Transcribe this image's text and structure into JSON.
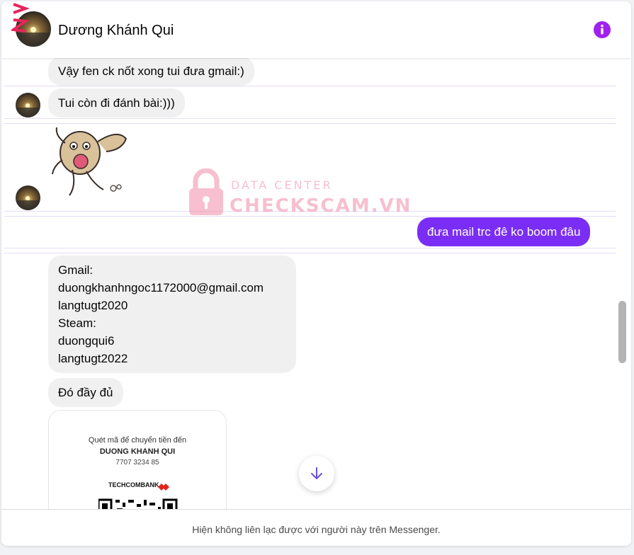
{
  "header": {
    "contact_name": "Dương Khánh Qui",
    "icons": {
      "info": "info-circle-icon",
      "avatar": "contact-avatar"
    }
  },
  "messages": [
    {
      "direction": "incoming",
      "text": "Vậy fen ck nốt xong tui đưa gmail:)"
    },
    {
      "direction": "incoming",
      "text": "Tui còn đi đánh bài:)))"
    },
    {
      "direction": "incoming",
      "type": "sticker",
      "sticker": "dancing-dog-sticker"
    },
    {
      "direction": "outgoing",
      "text": "đưa mail trc đê ko boom đâu"
    },
    {
      "direction": "incoming",
      "text": "Gmail:\nduongkhanhngoc1172000@gmail.com\nlangtugt2020\nSteam:\nduongqui6\nlangtugt2022"
    },
    {
      "direction": "incoming",
      "text": "Đó đầy đủ"
    },
    {
      "direction": "incoming",
      "type": "image",
      "qr": {
        "line1": "Quét mã để chuyển tiền đến",
        "line2": "DUONG KHANH QUI",
        "line3": "7707 3234 85",
        "bank": "TECHCOMBANK"
      }
    }
  ],
  "watermark": {
    "top": "DATA CENTER",
    "bottom": "CHECKSCAM.VN"
  },
  "footer": {
    "notice": "Hiện không liên lạc được với người này trên Messenger."
  },
  "colors": {
    "outgoing_bubble": "#7a2ef5",
    "incoming_bubble": "#f0f0f0",
    "accent": "#a020f0",
    "watermark": "#f18ba8"
  }
}
